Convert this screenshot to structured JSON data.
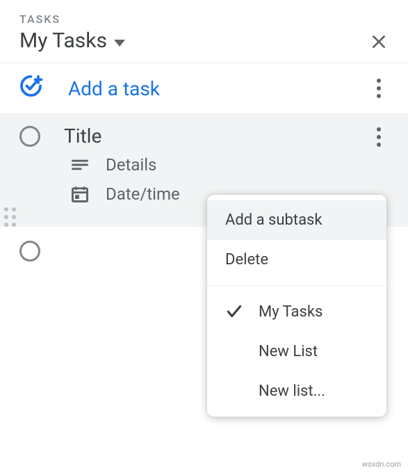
{
  "header": {
    "label": "TASKS",
    "listName": "My Tasks"
  },
  "addTask": {
    "label": "Add a task"
  },
  "task": {
    "title": "Title",
    "details": "Details",
    "datetime": "Date/time"
  },
  "menu": {
    "addSubtask": "Add a subtask",
    "delete": "Delete",
    "lists": [
      {
        "name": "My Tasks",
        "checked": true
      },
      {
        "name": "New List",
        "checked": false
      },
      {
        "name": "New list...",
        "checked": false
      }
    ]
  },
  "watermark": "wsxdn.com"
}
